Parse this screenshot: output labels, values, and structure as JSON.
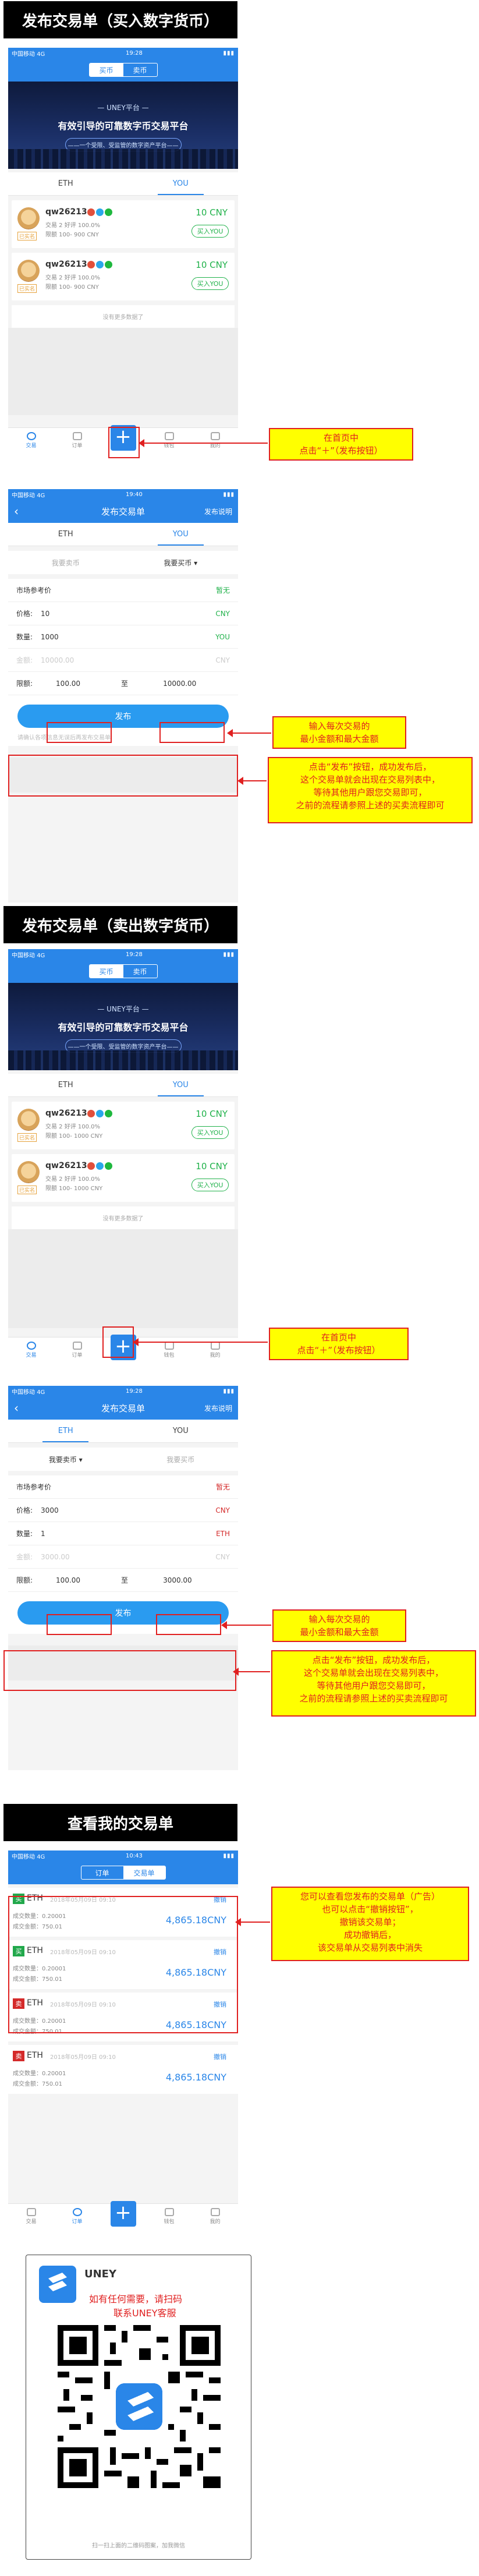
{
  "status": {
    "carrier": "中国移动",
    "net": "4G",
    "time1": "19:28",
    "time2": "19:40",
    "time3": "10:43"
  },
  "section1": {
    "title": "发布交易单（买入数字货币）"
  },
  "section2": {
    "title": "发布交易单（卖出数字货币）"
  },
  "section3": {
    "title": "查看我的交易单"
  },
  "market": {
    "seg_buy": "买币",
    "seg_sell": "卖币",
    "hero_logo": "— UNEY平台 —",
    "hero_title": "有效引导的可靠数字币交易平台",
    "hero_sub": "——一个受限、受监管的数字资产平台——",
    "tab_eth": "ETH",
    "tab_you": "YOU",
    "listings_buy": [
      {
        "user": "qw26213",
        "realname": "已实名",
        "deals": "交易 2 好评 100.0%",
        "limit": "限额 100- 900 CNY",
        "price": "10 CNY",
        "action": "买入YOU"
      },
      {
        "user": "qw26213",
        "realname": "已实名",
        "deals": "交易 2 好评 100.0%",
        "limit": "限额 100- 900 CNY",
        "price": "10 CNY",
        "action": "买入YOU"
      }
    ],
    "listings_sell": [
      {
        "user": "qw26213",
        "realname": "已实名",
        "deals": "交易 2 好评 100.0%",
        "limit": "限额 100- 1000 CNY",
        "price": "10 CNY",
        "action": "买入YOU"
      },
      {
        "user": "qw26213",
        "realname": "已实名",
        "deals": "交易 2 好评 100.0%",
        "limit": "限额 100- 1000 CNY",
        "price": "10 CNY",
        "action": "买入YOU"
      }
    ],
    "no_more": "没有更多数据了"
  },
  "bottom_nav": {
    "trade": "交易",
    "orders": "订单",
    "plus": "+",
    "assets": "钱包",
    "me": "我的"
  },
  "publish_buy": {
    "title": "发布交易单",
    "right": "发布说明",
    "tab_eth": "ETH",
    "tab_you": "YOU",
    "opt_sell": "我要卖币",
    "opt_buy": "我要买币 ▾",
    "ref_label": "市场参考价",
    "ref_value": "暂无",
    "price_label": "价格:",
    "price_value": "10",
    "price_unit": "CNY",
    "qty_label": "数量:",
    "qty_value": "1000",
    "qty_unit": "YOU",
    "amount_label": "金额:",
    "amount_value": "10000.00",
    "amount_unit": "CNY",
    "limit_label": "限额:",
    "limit_min": "100.00",
    "limit_to": "至",
    "limit_max": "10000.00",
    "publish": "发布",
    "hint": "请确认各项信息无误后再发布交易单"
  },
  "publish_sell": {
    "title": "发布交易单",
    "right": "发布说明",
    "tab_eth": "ETH",
    "tab_you": "YOU",
    "opt_sell": "我要卖币 ▾",
    "opt_buy": "我要买币",
    "ref_label": "市场参考价",
    "ref_value": "暂无",
    "price_label": "价格:",
    "price_value": "3000",
    "price_unit": "CNY",
    "qty_label": "数量:",
    "qty_value": "1",
    "qty_unit": "ETH",
    "amount_label": "金额:",
    "amount_value": "3000.00",
    "amount_unit": "CNY",
    "limit_label": "限额:",
    "limit_min": "100.00",
    "limit_to": "至",
    "limit_max": "3000.00",
    "publish": "发布"
  },
  "notes": {
    "click_plus_1": "在首页中",
    "click_plus_2": "点击“＋”（发布按钮）",
    "enter_limits_1": "输入每次交易的",
    "enter_limits_2": "最小金额和最大金额",
    "after_publish_1": "点击“发布”按钮，成功发布后，",
    "after_publish_2": "这个交易单就会出现在交易列表中，",
    "after_publish_3": "等待其他用户跟您交易即可，",
    "after_publish_4": "之前的流程请参照上述的买卖流程即可",
    "cancel_1": "您可以查看您发布的交易单（广告）",
    "cancel_2": "也可以点击“撤销按钮”，",
    "cancel_3": "撤销该交易单；",
    "cancel_4": "成功撤销后，",
    "cancel_5": "该交易单从交易列表中消失"
  },
  "orders": {
    "seg_orders": "订单",
    "seg_trades": "交易单",
    "rows": [
      {
        "type": "买",
        "cur": "ETH",
        "time": "2018年05月09日 09:10",
        "cancel": "撤销",
        "deal_qty": "成交数量：0.20001",
        "deal_amt": "成交金额：750.01",
        "amount": "4,865.18CNY"
      },
      {
        "type": "买",
        "cur": "ETH",
        "time": "2018年05月09日 09:10",
        "cancel": "撤销",
        "deal_qty": "成交数量：0.20001",
        "deal_amt": "成交金额：750.01",
        "amount": "4,865.18CNY"
      },
      {
        "type": "卖",
        "cur": "ETH",
        "time": "2018年05月09日 09:10",
        "cancel": "撤销",
        "deal_qty": "成交数量：0.20001",
        "deal_amt": "成交金额：750.01",
        "amount": "4,865.18CNY"
      },
      {
        "type": "卖",
        "cur": "ETH",
        "time": "2018年05月09日 09:10",
        "cancel": "撤销",
        "deal_qty": "成交数量：0.20001",
        "deal_amt": "成交金额：750.01",
        "amount": "4,865.18CNY"
      }
    ]
  },
  "qr": {
    "brand": "UNEY",
    "line1": "如有任何需要，请扫码",
    "line2": "联系UNEY客服",
    "footer": "扫一扫上面的二维码图案，加我微信"
  },
  "colors": {
    "primary": "#2a86e8",
    "green": "#21b24b",
    "red": "#e02020",
    "note_bg": "#ffff00"
  }
}
